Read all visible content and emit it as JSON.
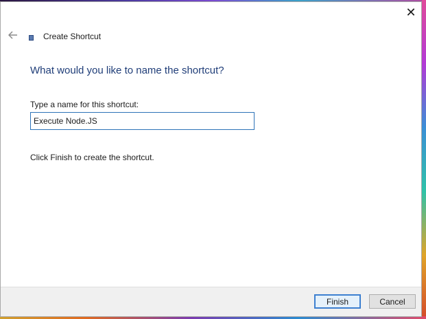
{
  "dialog": {
    "title": "Create Shortcut",
    "close_icon": "close-icon",
    "back_icon": "back-arrow-icon",
    "wizard_icon": "shortcut-icon"
  },
  "main": {
    "heading": "What would you like to name the shortcut?",
    "field_label": "Type a name for this shortcut:",
    "name_value": "Execute Node.JS",
    "info_text": "Click Finish to create the shortcut."
  },
  "footer": {
    "finish_label": "Finish",
    "cancel_label": "Cancel"
  },
  "colors": {
    "heading": "#1f3d78",
    "input_border": "#2d72b8",
    "primary_button_border": "#3c7fd0",
    "footer_bg": "#f0f0f0"
  }
}
